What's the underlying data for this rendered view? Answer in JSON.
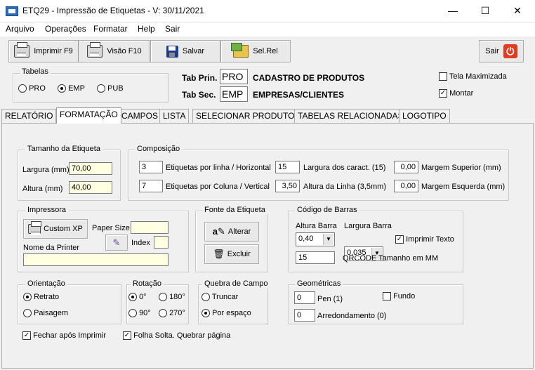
{
  "window": {
    "title": "ETQ29 - Impressão de Etiquetas - V: 30/11/2021",
    "minimize": "—",
    "maximize": "☐",
    "close": "✕"
  },
  "menu": [
    "Arquivo",
    "Operações",
    "Formatar",
    "Help",
    "Sair"
  ],
  "toolbar": {
    "print": "Imprimir F9",
    "preview": "Visão F10",
    "save": "Salvar",
    "selrel": "Sel.Rel",
    "exit": "Sair"
  },
  "tabelas": {
    "label": "Tabelas",
    "options": [
      "PRO",
      "EMP",
      "PUB"
    ],
    "selected": "EMP"
  },
  "tab_prin": {
    "label": "Tab Prin.",
    "value": "PRO",
    "desc": "CADASTRO DE PRODUTOS"
  },
  "tab_sec": {
    "label": "Tab Sec.",
    "value": "EMP",
    "desc": "EMPRESAS/CLIENTES"
  },
  "options": {
    "tela_maximizada": "Tela Maximizada",
    "tela_maximizada_checked": false,
    "montar": "Montar",
    "montar_checked": true
  },
  "tabs": [
    "RELATÓRIO",
    "FORMATAÇÃO",
    "CAMPOS",
    "LISTA",
    "SELECIONAR PRODUTOS",
    "TABELAS RELACIONADAS",
    "LOGOTIPO"
  ],
  "active_tab": "FORMATAÇÃO",
  "tamanho": {
    "label": "Tamanho da Etiqueta",
    "largura_label": "Largura (mm)",
    "largura": "70,00",
    "altura_label": "Altura (mm)",
    "altura": "40,00"
  },
  "composicao": {
    "label": "Composição",
    "por_linha": "3",
    "por_linha_label": "Etiquetas por linha / Horizontal",
    "por_coluna": "7",
    "por_coluna_label": "Etiquetas por Coluna / Vertical",
    "largura_caract": "15",
    "largura_caract_label": "Largura dos caract. (15)",
    "altura_linha": "3,50",
    "altura_linha_label": "Altura da Linha (3,5mm)",
    "margem_sup": "0,00",
    "margem_sup_label": "Margem Superior (mm)",
    "margem_esq": "0,00",
    "margem_esq_label": "Margem Esquerda (mm)"
  },
  "impressora": {
    "label": "Impressora",
    "custom": "Custom XP",
    "paper_size": "Paper Size",
    "paper_value": "",
    "index": "Index",
    "index_value": "",
    "printer_name_label": "Nome da Printer",
    "printer_name": ""
  },
  "fonte": {
    "label": "Fonte da Etiqueta",
    "alterar": "Alterar",
    "excluir": "Excluir"
  },
  "barras": {
    "label": "Código de Barras",
    "altura_label": "Altura Barra",
    "altura": "0,40",
    "largura_label": "Largura Barra",
    "largura": "0,035",
    "imprimir_texto": "Imprimir Texto",
    "imprimir_checked": true,
    "qrcode": "15",
    "qrcode_label": "QRCODE Tamanho em MM"
  },
  "orientacao": {
    "label": "Orientação",
    "retrato": "Retrato",
    "paisagem": "Paisagem",
    "selected": "Retrato"
  },
  "rotacao": {
    "label": "Rotação",
    "r0": "0°",
    "r90": "90°",
    "r180": "180°",
    "r270": "270°",
    "selected": "0°"
  },
  "quebra": {
    "label": "Quebra de Campo",
    "truncar": "Truncar",
    "espaco": "Por espaço",
    "selected": "Por espaço"
  },
  "geometricas": {
    "label": "Geométricas",
    "pen": "0",
    "pen_label": "Pen (1)",
    "arred": "0",
    "arred_label": "Arredondamento (0)",
    "fundo": "Fundo",
    "fundo_checked": false
  },
  "footer": {
    "fechar": "Fechar após Imprimir",
    "fechar_checked": true,
    "folha": "Folha Solta.  Quebrar página",
    "folha_checked": true
  }
}
